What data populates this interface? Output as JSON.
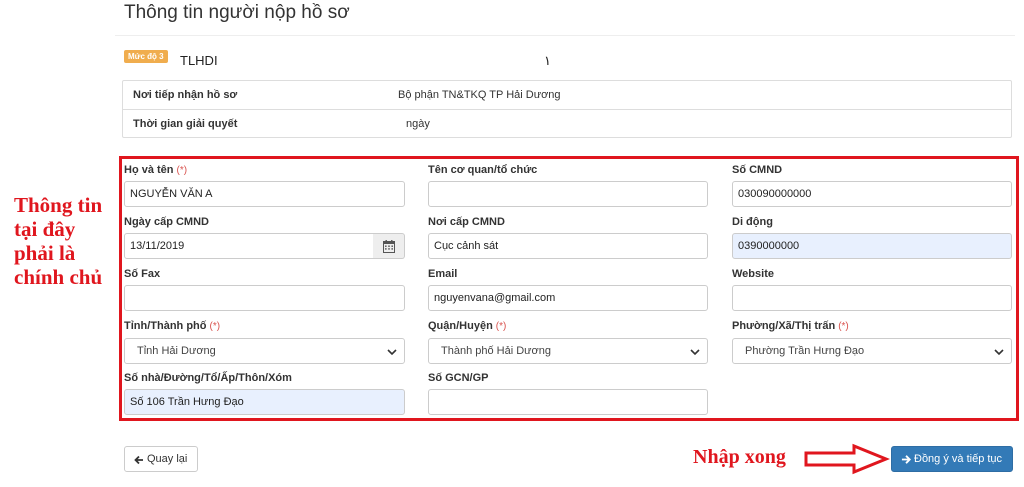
{
  "page": {
    "title": "Thông tin người nộp hồ sơ"
  },
  "procedure": {
    "level_badge": "Mức độ 3",
    "code": "TLHDI",
    "name": "١"
  },
  "info": {
    "rows": [
      {
        "label": "Nơi tiếp nhận hồ sơ",
        "value": "Bộ phận TN&TKQ TP Hải Dương"
      },
      {
        "label": "Thời gian giải quyết",
        "value": "ngày"
      }
    ]
  },
  "form": {
    "full_name": {
      "label": "Họ và tên",
      "required": "(*)",
      "value": "NGUYỄN VĂN A"
    },
    "organization": {
      "label": "Tên cơ quan/tổ chức",
      "value": ""
    },
    "id_number": {
      "label": "Số CMND",
      "value": "030090000000"
    },
    "id_issue_date": {
      "label": "Ngày cấp CMND",
      "value": "13/11/2019",
      "icon": "calendar-icon"
    },
    "id_issue_place": {
      "label": "Nơi cấp CMND",
      "value": "Cục cảnh sát"
    },
    "mobile": {
      "label": "Di động",
      "value": "0390000000"
    },
    "fax": {
      "label": "Số Fax",
      "value": ""
    },
    "email": {
      "label": "Email",
      "value": "nguyenvana@gmail.com"
    },
    "website": {
      "label": "Website",
      "value": ""
    },
    "province": {
      "label": "Tỉnh/Thành phố",
      "required": "(*)",
      "value": "Tỉnh Hải Dương"
    },
    "district": {
      "label": "Quận/Huyện",
      "required": "(*)",
      "value": "Thành phố Hải Dương"
    },
    "ward": {
      "label": "Phường/Xã/Thị trấn",
      "required": "(*)",
      "value": "Phường Trần Hưng Đạo"
    },
    "address": {
      "label": "Số nhà/Đường/Tổ/Ấp/Thôn/Xóm",
      "value": "Số 106 Trần Hưng Đạo"
    },
    "license_number": {
      "label": "Số GCN/GP",
      "value": ""
    }
  },
  "annotations": {
    "side_note": [
      "Thông tin",
      "tại đây",
      "phải là",
      "chính chủ"
    ],
    "done_note": "Nhập xong",
    "highlight_color": "#e0161e"
  },
  "actions": {
    "back_label": "Quay lại",
    "submit_label": "Đồng ý và tiếp tục",
    "primary_color": "#337ab7"
  }
}
